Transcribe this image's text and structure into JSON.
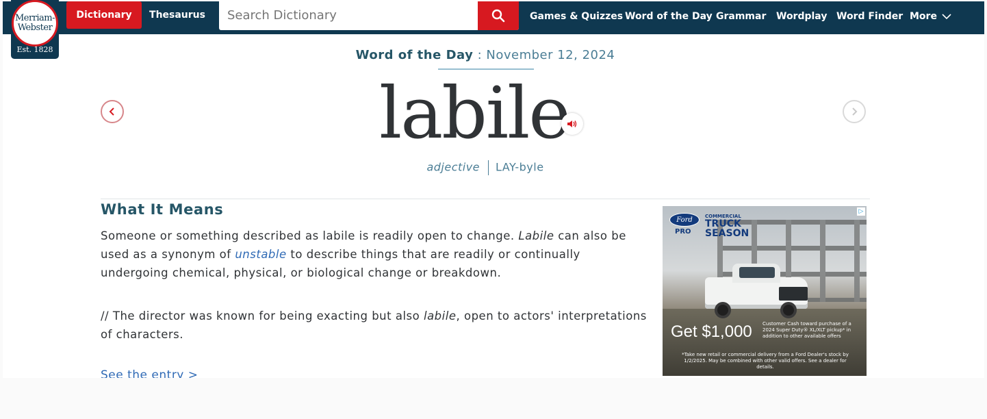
{
  "header": {
    "logo_line1": "Merriam-",
    "logo_line2": "Webster",
    "logo_est": "Est. 1828",
    "tab_dictionary": "Dictionary",
    "tab_thesaurus": "Thesaurus",
    "search_placeholder": "Search Dictionary",
    "nav": [
      "Games & Quizzes",
      "Word of the Day",
      "Grammar",
      "Wordplay",
      "Word Finder",
      "More"
    ]
  },
  "wotd": {
    "label": "Word of the Day",
    "separator": " : ",
    "date": "November 12, 2024",
    "word": "labile",
    "part_of_speech": "adjective",
    "pronunciation": "LAY-byle"
  },
  "meaning": {
    "title": "What It Means",
    "def_part1": "Someone or something described as labile is readily open to change. ",
    "def_italic": "Labile",
    "def_part2": " can also be used as a synonym of ",
    "def_link": "unstable",
    "def_part3": " to describe things that are readily or continually undergoing chemical, physical, or biological change or breakdown.",
    "example_part1": "// The director was known for being exacting but also ",
    "example_italic": "labile",
    "example_part2": ", open to actors' interpretations of characters.",
    "see_entry": "See the entry >"
  },
  "ad": {
    "brand": "Ford",
    "pro": "PRO",
    "line1": "COMMERCIAL",
    "line2": "TRUCK",
    "line3": "SEASON",
    "offer": "Get $1,000",
    "fine_print1": "Customer Cash toward purchase of a 2024 Super Duty® XL/XLT pickup* in addition to other available offers",
    "fine_print2": "*Take new retail or commercial delivery from a Ford Dealer's stock by 1/2/2025. May be combined with other valid offers. See a dealer for details."
  },
  "colors": {
    "header_bg": "#0f3850",
    "brand_red": "#d71920",
    "heading_blue": "#265667",
    "link_blue": "#2f6ab5"
  },
  "icons": {
    "search": "search-icon",
    "prev": "chevron-left-icon",
    "next": "chevron-right-icon",
    "audio": "speaker-icon",
    "more": "chevron-down-icon"
  }
}
